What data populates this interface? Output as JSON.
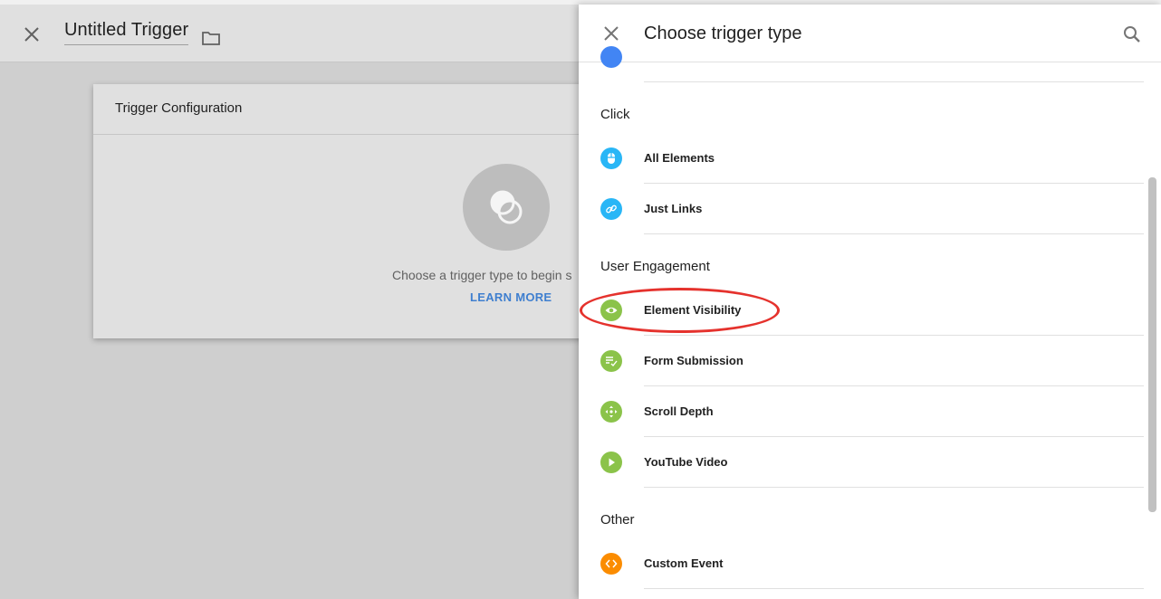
{
  "editor": {
    "title": "Untitled Trigger",
    "card_title": "Trigger Configuration",
    "prompt_text": "Choose a trigger type to begin s",
    "learn_more": "LEARN MORE"
  },
  "panel": {
    "title": "Choose trigger type",
    "sections": [
      {
        "label": "Click",
        "items": [
          {
            "label": "All Elements",
            "icon": "mouse-icon",
            "color": "#29b6f6"
          },
          {
            "label": "Just Links",
            "icon": "link-icon",
            "color": "#29b6f6"
          }
        ]
      },
      {
        "label": "User Engagement",
        "items": [
          {
            "label": "Element Visibility",
            "icon": "eye-icon",
            "color": "#8bc34a"
          },
          {
            "label": "Form Submission",
            "icon": "form-check-icon",
            "color": "#8bc34a"
          },
          {
            "label": "Scroll Depth",
            "icon": "scroll-arrows-icon",
            "color": "#8bc34a"
          },
          {
            "label": "YouTube Video",
            "icon": "play-icon",
            "color": "#8bc34a"
          }
        ]
      },
      {
        "label": "Other",
        "items": [
          {
            "label": "Custom Event",
            "icon": "code-brackets-icon",
            "color": "#fb8c00"
          }
        ]
      }
    ]
  },
  "colors": {
    "highlight": "#e5322d",
    "link": "#3f7fcf",
    "partial_item": "#4285f4"
  }
}
